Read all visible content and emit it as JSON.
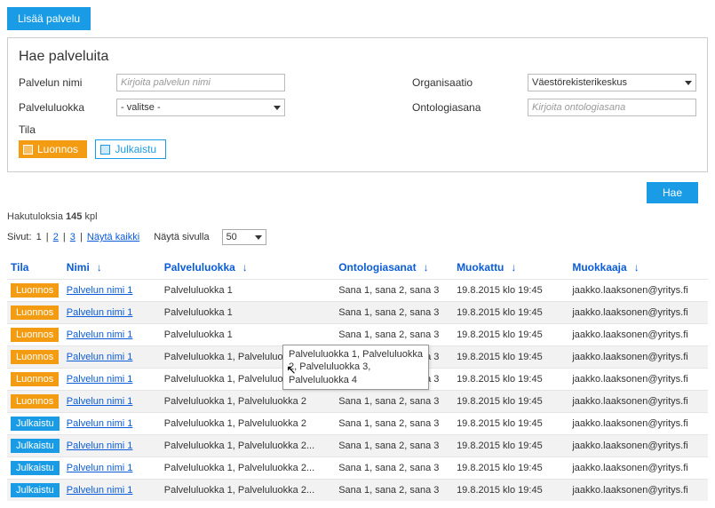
{
  "top_button": "Lisää palvelu",
  "search": {
    "title": "Hae palveluita",
    "name_label": "Palvelun nimi",
    "name_placeholder": "Kirjoita palvelun nimi",
    "class_label": "Palveluluokka",
    "class_value": "- valitse -",
    "org_label": "Organisaatio",
    "org_value": "Väestörekisterikeskus",
    "onto_label": "Ontologiasana",
    "onto_placeholder": "Kirjoita ontologiasana",
    "tila_label": "Tila",
    "toggle_draft": "Luonnos",
    "toggle_published": "Julkaistu",
    "search_button": "Hae"
  },
  "results": {
    "count_prefix": "Hakutuloksia ",
    "count": "145",
    "count_suffix": " kpl",
    "pager_label": "Sivut:",
    "pages": [
      "1",
      "2",
      "3"
    ],
    "show_all": "Näytä kaikki",
    "per_page_label": "Näytä sivulla",
    "per_page_value": "50"
  },
  "columns": {
    "tila": "Tila",
    "nimi": "Nimi",
    "pl": "Palveluluokka",
    "onto": "Ontologiasanat",
    "mod": "Muokattu",
    "who": "Muokkaaja"
  },
  "tooltip": {
    "line1": "Palveluluokka 1, Palveluluokka",
    "line2": "2, Palveluluokka 3,",
    "line3": "Palveluluokka 4"
  },
  "rows": [
    {
      "tila": "Luonnos",
      "tila_c": "orange",
      "nimi": "Palvelun nimi 1",
      "pl": "Palveluluokka 1",
      "onto": "Sana 1, sana 2, sana 3",
      "mod": "19.8.2015 klo 19:45",
      "who": "jaakko.laaksonen@yritys.fi"
    },
    {
      "tila": "Luonnos",
      "tila_c": "orange",
      "nimi": "Palvelun nimi 1",
      "pl": "Palveluluokka 1",
      "onto": "Sana 1, sana 2, sana 3",
      "mod": "19.8.2015 klo 19:45",
      "who": "jaakko.laaksonen@yritys.fi"
    },
    {
      "tila": "Luonnos",
      "tila_c": "orange",
      "nimi": "Palvelun nimi 1",
      "pl": "Palveluluokka 1",
      "onto": "Sana 1, sana 2, sana 3",
      "mod": "19.8.2015 klo 19:45",
      "who": "jaakko.laaksonen@yritys.fi"
    },
    {
      "tila": "Luonnos",
      "tila_c": "orange",
      "nimi": "Palvelun nimi 1",
      "pl": "Palveluluokka 1, Palveluluokka 2",
      "onto": "Sana 1, sana 2, sana 3",
      "mod": "19.8.2015 klo 19:45",
      "who": "jaakko.laaksonen@yritys.fi"
    },
    {
      "tila": "Luonnos",
      "tila_c": "orange",
      "nimi": "Palvelun nimi 1",
      "pl": "Palveluluokka 1, Palveluluokka 2",
      "onto": "Sana 1, sana 2, sana 3",
      "mod": "19.8.2015 klo 19:45",
      "who": "jaakko.laaksonen@yritys.fi"
    },
    {
      "tila": "Luonnos",
      "tila_c": "orange",
      "nimi": "Palvelun nimi 1",
      "pl": "Palveluluokka 1, Palveluluokka 2",
      "onto": "Sana 1, sana 2, sana 3",
      "mod": "19.8.2015 klo 19:45",
      "who": "jaakko.laaksonen@yritys.fi"
    },
    {
      "tila": "Julkaistu",
      "tila_c": "blue",
      "nimi": "Palvelun nimi 1",
      "pl": "Palveluluokka 1, Palveluluokka 2",
      "onto": "Sana 1, sana 2, sana 3",
      "mod": "19.8.2015 klo 19:45",
      "who": "jaakko.laaksonen@yritys.fi"
    },
    {
      "tila": "Julkaistu",
      "tila_c": "blue",
      "nimi": "Palvelun nimi 1",
      "pl": "Palveluluokka 1, Palveluluokka 2...",
      "onto": "Sana 1, sana 2, sana 3",
      "mod": "19.8.2015 klo 19:45",
      "who": "jaakko.laaksonen@yritys.fi"
    },
    {
      "tila": "Julkaistu",
      "tila_c": "blue",
      "nimi": "Palvelun nimi 1",
      "pl": "Palveluluokka 1, Palveluluokka 2...",
      "onto": "Sana 1, sana 2, sana 3",
      "mod": "19.8.2015 klo 19:45",
      "who": "jaakko.laaksonen@yritys.fi"
    },
    {
      "tila": "Julkaistu",
      "tila_c": "blue",
      "nimi": "Palvelun nimi 1",
      "pl": "Palveluluokka 1, Palveluluokka 2...",
      "onto": "Sana 1, sana 2, sana 3",
      "mod": "19.8.2015 klo 19:45",
      "who": "jaakko.laaksonen@yritys.fi"
    }
  ]
}
